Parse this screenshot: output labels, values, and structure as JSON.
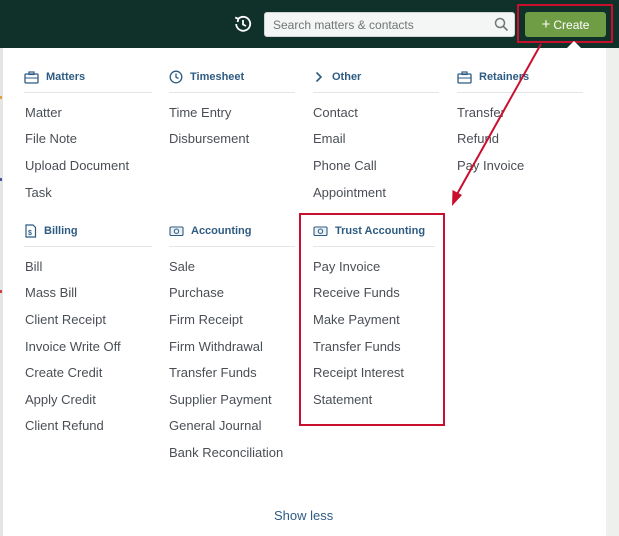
{
  "topbar": {
    "search_placeholder": "Search matters & contacts",
    "create_label": "Create",
    "icons": {
      "history": "history-icon",
      "search": "search-icon",
      "plus": "plus-icon"
    }
  },
  "menu": {
    "columns_row1": [
      {
        "heading": "Matters",
        "icon": "briefcase-icon",
        "items": [
          "Matter",
          "File Note",
          "Upload Document",
          "Task"
        ]
      },
      {
        "heading": "Timesheet",
        "icon": "clock-icon",
        "items": [
          "Time Entry",
          "Disbursement"
        ]
      },
      {
        "heading": "Other",
        "icon": "chevron-right-icon",
        "items": [
          "Contact",
          "Email",
          "Phone Call",
          "Appointment"
        ]
      },
      {
        "heading": "Retainers",
        "icon": "briefcase-icon",
        "items": [
          "Transfer",
          "Refund",
          "Pay Invoice"
        ]
      }
    ],
    "columns_row2": [
      {
        "heading": "Billing",
        "icon": "invoice-icon",
        "items": [
          "Bill",
          "Mass Bill",
          "Client Receipt",
          "Invoice Write Off",
          "Create Credit",
          "Apply Credit",
          "Client Refund"
        ]
      },
      {
        "heading": "Accounting",
        "icon": "banknote-icon",
        "items": [
          "Sale",
          "Purchase",
          "Firm Receipt",
          "Firm Withdrawal",
          "Transfer Funds",
          "Supplier Payment",
          "General Journal",
          "Bank Reconciliation"
        ]
      },
      {
        "heading": "Trust Accounting",
        "icon": "banknote-icon",
        "items": [
          "Pay Invoice",
          "Receive Funds",
          "Make Payment",
          "Transfer Funds",
          "Receipt Interest",
          "Statement"
        ]
      }
    ],
    "show_less": "Show less"
  },
  "annotation": {
    "color": "#c8102e"
  },
  "colors": {
    "topbar": "#10302a",
    "create_button": "#6f9d45",
    "heading": "#2e5b82",
    "item_text": "#4a4f55"
  }
}
